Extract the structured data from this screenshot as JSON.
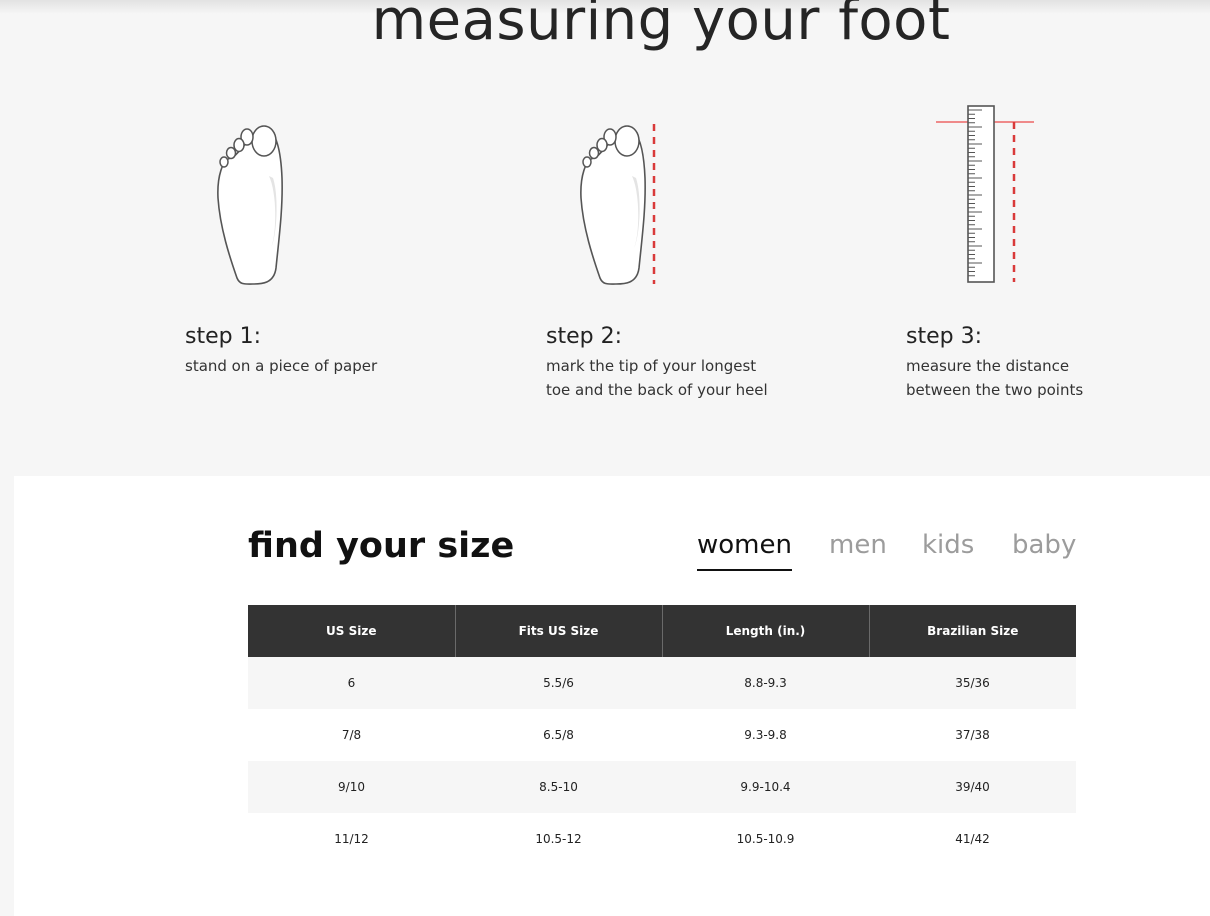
{
  "header": {
    "title": "measuring your foot"
  },
  "steps": [
    {
      "title": "step 1:",
      "desc_lines": [
        "stand on a piece of paper"
      ],
      "illustration": "foot-outline-icon"
    },
    {
      "title": "step 2:",
      "desc_lines": [
        "mark the tip of your longest",
        "toe and the back of your heel"
      ],
      "illustration": "foot-with-mark-icon"
    },
    {
      "title": "step 3:",
      "desc_lines": [
        "measure the distance",
        "between the two points"
      ],
      "illustration": "ruler-measure-icon"
    }
  ],
  "size_guide": {
    "title": "find your size",
    "tabs": [
      {
        "label": "women",
        "active": true
      },
      {
        "label": "men",
        "active": false
      },
      {
        "label": "kids",
        "active": false
      },
      {
        "label": "baby",
        "active": false
      }
    ],
    "table": {
      "headers": [
        "US Size",
        "Fits US Size",
        "Length (in.)",
        "Brazilian Size"
      ],
      "rows": [
        [
          "6",
          "5.5/6",
          "8.8-9.3",
          "35/36"
        ],
        [
          "7/8",
          "6.5/8",
          "9.3-9.8",
          "37/38"
        ],
        [
          "9/10",
          "8.5-10",
          "9.9-10.4",
          "39/40"
        ],
        [
          "11/12",
          "10.5-12",
          "10.5-10.9",
          "41/42"
        ]
      ]
    }
  },
  "colors": {
    "accent_red": "#d93a3a",
    "header_bg": "#333333",
    "page_bg": "#f6f6f6",
    "tab_inactive": "#9c9c9c"
  }
}
